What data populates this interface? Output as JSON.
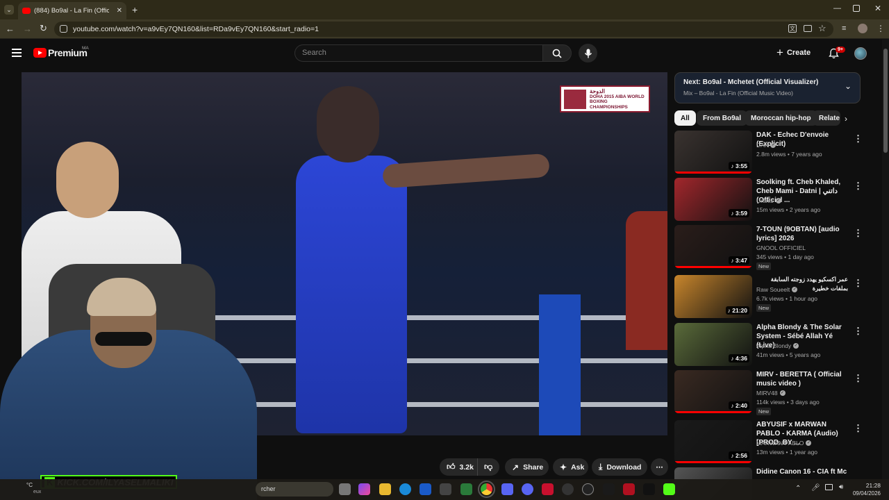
{
  "browser": {
    "tab_title": "(884) Bo9al - La Fin (Official Mu",
    "url": "youtube.com/watch?v=a9vEy7QN160&list=RDa9vEy7QN160&start_radio=1"
  },
  "header": {
    "brand": "Premium",
    "brand_region": "MA",
    "search_placeholder": "Search",
    "create_label": "Create",
    "notifications_badge": "9+"
  },
  "player": {
    "overlay_logo_text": "DOHA 2015 AIBA WORLD BOXING CHAMPIONSHIPS",
    "overlay_logo_arabic": "الدوحة"
  },
  "webcam": {
    "kick_text": "KICK.COM/ILYASELMALIKI"
  },
  "actions": {
    "like_count": "3.2k",
    "share_label": "Share",
    "ask_label": "Ask",
    "download_label": "Download"
  },
  "sidebar": {
    "next_title": "Next: Bo9al - Mchetet (Official Visualizer)",
    "next_subtitle": "Mix – Bo9al - La Fin (Official Music Video)",
    "chips": [
      "All",
      "From Bo9al",
      "Moroccan hip-hop",
      "Relate"
    ],
    "items": [
      {
        "title": "DAK - Echec D'envoie (Explicit)",
        "channel": "DAK",
        "verified": true,
        "meta": "2.8m views • 7 years ago",
        "duration": "3:55",
        "new": false,
        "thumb_color": "#3a3330"
      },
      {
        "title": "Soolking ft. Cheb Khaled, Cheb Mami - Datni | داتني (Officiel ...",
        "channel": "Uranis",
        "verified": true,
        "meta": "15m views • 2 years ago",
        "duration": "3:59",
        "new": false,
        "thumb_color": "#a3272c"
      },
      {
        "title": "7-TOUN (9OBTAN) [audio lyrics] 2026",
        "channel": "GNOOL OFFICIEL",
        "verified": false,
        "meta": "345 views • 1 day ago",
        "duration": "3:47",
        "new": true,
        "thumb_color": "#2a1d1a"
      },
      {
        "title": "عمر اكسكيو يهدد زوجته السابقة بملفات خطيرة",
        "channel": "Raw Soueelt",
        "verified": true,
        "meta": "6.7k views • 1 hour ago",
        "duration": "21:20",
        "new": true,
        "thumb_color": "#c8862c"
      },
      {
        "title": "Alpha Blondy & The Solar System - Sébé Allah Yé (Live)",
        "channel": "Alpha Blondy",
        "verified": true,
        "meta": "41m views • 5 years ago",
        "duration": "4:36",
        "new": false,
        "thumb_color": "#5a6b3a"
      },
      {
        "title": "MIRV - BERETTA ( Official music video )",
        "channel": "MIRV48",
        "verified": true,
        "meta": "114k views • 3 days ago",
        "duration": "2:40",
        "new": true,
        "thumb_color": "#3a2a22"
      },
      {
        "title": "ABYUSIF x MARWAN PABLO - KARMA (Audio) [PROD. BY ...",
        "channel": "MARWAN PABLO",
        "verified": true,
        "meta": "13m views • 1 year ago",
        "duration": "2:56",
        "new": false,
        "thumb_color": "#1a1a1a"
      },
      {
        "title": "Didine Canon 16 - CIA ft Mc",
        "channel": "",
        "verified": false,
        "meta": "",
        "duration": "",
        "new": false,
        "thumb_color": "#555"
      }
    ],
    "new_label": "New",
    "more_label": "⋮"
  },
  "taskbar": {
    "search_text": "rcher",
    "time": "21:28",
    "date": "09/04/2026",
    "temp_left": "°C",
    "weather_left": "eux"
  }
}
